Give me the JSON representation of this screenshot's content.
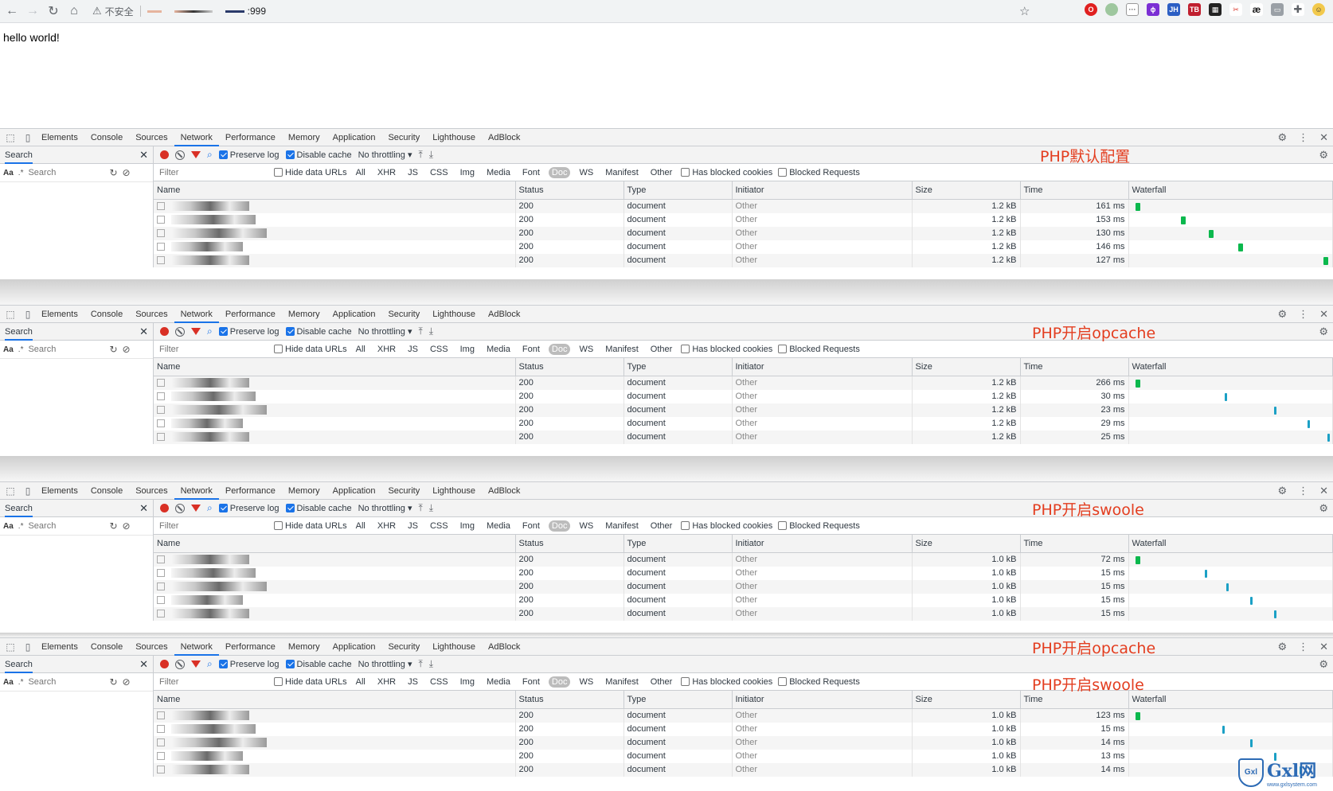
{
  "browser": {
    "insecure_label": "不安全",
    "port": ":999",
    "page_text": "hello world!"
  },
  "devtools": {
    "tabs": [
      "Elements",
      "Console",
      "Sources",
      "Network",
      "Performance",
      "Memory",
      "Application",
      "Security",
      "Lighthouse",
      "AdBlock"
    ],
    "active_tab": "Network",
    "search_label": "Search",
    "aa_label": "Aa",
    "regex_label": ".*",
    "search_placeholder": "Search",
    "preserve_log": "Preserve log",
    "disable_cache": "Disable cache",
    "throttling": "No throttling",
    "filter_placeholder": "Filter",
    "hide_data_urls": "Hide data URLs",
    "filter_types": [
      "All",
      "XHR",
      "JS",
      "CSS",
      "Img",
      "Media",
      "Font",
      "Doc",
      "WS",
      "Manifest",
      "Other"
    ],
    "active_filter": "Doc",
    "has_blocked_cookies": "Has blocked cookies",
    "blocked_requests": "Blocked Requests",
    "columns": [
      "Name",
      "Status",
      "Type",
      "Initiator",
      "Size",
      "Time",
      "Waterfall"
    ]
  },
  "panels": [
    {
      "note": [
        "PHP默认配置"
      ],
      "rows": [
        {
          "status": "200",
          "type": "document",
          "initiator": "Other",
          "size": "1.2 kB",
          "time": "161 ms",
          "wf": 0.02,
          "color": "#0bb84d"
        },
        {
          "status": "200",
          "type": "document",
          "initiator": "Other",
          "size": "1.2 kB",
          "time": "153 ms",
          "wf": 0.25,
          "color": "#0bb84d"
        },
        {
          "status": "200",
          "type": "document",
          "initiator": "Other",
          "size": "1.2 kB",
          "time": "130 ms",
          "wf": 0.39,
          "color": "#0bb84d"
        },
        {
          "status": "200",
          "type": "document",
          "initiator": "Other",
          "size": "1.2 kB",
          "time": "146 ms",
          "wf": 0.54,
          "color": "#0bb84d"
        },
        {
          "status": "200",
          "type": "document",
          "initiator": "Other",
          "size": "1.2 kB",
          "time": "127 ms",
          "wf": 0.97,
          "color": "#0bb84d"
        }
      ]
    },
    {
      "note": [
        "PHP开启opcache"
      ],
      "rows": [
        {
          "status": "200",
          "type": "document",
          "initiator": "Other",
          "size": "1.2 kB",
          "time": "266 ms",
          "wf": 0.02,
          "color": "#0bb84d"
        },
        {
          "status": "200",
          "type": "document",
          "initiator": "Other",
          "size": "1.2 kB",
          "time": "30 ms",
          "wf": 0.47,
          "color": "#1ba0c5"
        },
        {
          "status": "200",
          "type": "document",
          "initiator": "Other",
          "size": "1.2 kB",
          "time": "23 ms",
          "wf": 0.72,
          "color": "#1ba0c5"
        },
        {
          "status": "200",
          "type": "document",
          "initiator": "Other",
          "size": "1.2 kB",
          "time": "29 ms",
          "wf": 0.89,
          "color": "#1ba0c5"
        },
        {
          "status": "200",
          "type": "document",
          "initiator": "Other",
          "size": "1.2 kB",
          "time": "25 ms",
          "wf": 0.99,
          "color": "#1ba0c5"
        }
      ]
    },
    {
      "note": [
        "PHP开启swoole"
      ],
      "rows": [
        {
          "status": "200",
          "type": "document",
          "initiator": "Other",
          "size": "1.0 kB",
          "time": "72 ms",
          "wf": 0.02,
          "color": "#0bb84d"
        },
        {
          "status": "200",
          "type": "document",
          "initiator": "Other",
          "size": "1.0 kB",
          "time": "15 ms",
          "wf": 0.37,
          "color": "#1ba0c5"
        },
        {
          "status": "200",
          "type": "document",
          "initiator": "Other",
          "size": "1.0 kB",
          "time": "15 ms",
          "wf": 0.48,
          "color": "#1ba0c5"
        },
        {
          "status": "200",
          "type": "document",
          "initiator": "Other",
          "size": "1.0 kB",
          "time": "15 ms",
          "wf": 0.6,
          "color": "#1ba0c5"
        },
        {
          "status": "200",
          "type": "document",
          "initiator": "Other",
          "size": "1.0 kB",
          "time": "15 ms",
          "wf": 0.72,
          "color": "#1ba0c5"
        }
      ]
    },
    {
      "note": [
        "PHP开启opcache",
        "PHP开启swoole"
      ],
      "rows": [
        {
          "status": "200",
          "type": "document",
          "initiator": "Other",
          "size": "1.0 kB",
          "time": "123 ms",
          "wf": 0.02,
          "color": "#0bb84d"
        },
        {
          "status": "200",
          "type": "document",
          "initiator": "Other",
          "size": "1.0 kB",
          "time": "15 ms",
          "wf": 0.46,
          "color": "#1ba0c5"
        },
        {
          "status": "200",
          "type": "document",
          "initiator": "Other",
          "size": "1.0 kB",
          "time": "14 ms",
          "wf": 0.6,
          "color": "#1ba0c5"
        },
        {
          "status": "200",
          "type": "document",
          "initiator": "Other",
          "size": "1.0 kB",
          "time": "13 ms",
          "wf": 0.72,
          "color": "#1ba0c5"
        },
        {
          "status": "200",
          "type": "document",
          "initiator": "Other",
          "size": "1.0 kB",
          "time": "14 ms",
          "wf": 0.85,
          "color": "#1ba0c5"
        }
      ]
    }
  ],
  "watermark": {
    "logo": "Gxl",
    "text": "Gxl网",
    "url": "www.gxlsystem.com"
  },
  "colors": {
    "accent": "#1a73e8",
    "note": "#e33d1f",
    "record": "#d93025"
  }
}
